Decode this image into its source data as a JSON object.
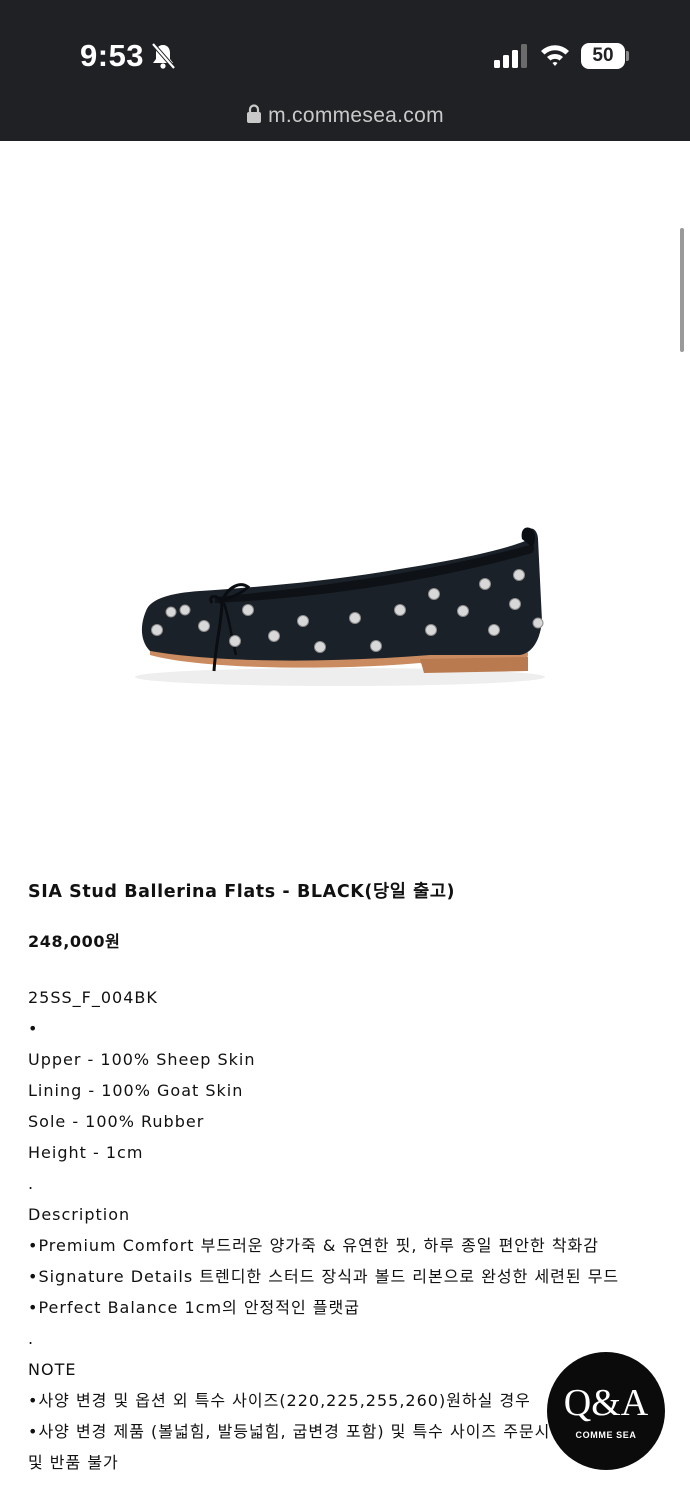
{
  "status_bar": {
    "time": "9:53",
    "battery": "50"
  },
  "browser": {
    "url": "m.commesea.com"
  },
  "product": {
    "image_alt": "black leather ballerina flat with silver studs",
    "title": "SIA Stud Ballerina Flats - BLACK(당일 출고)",
    "price": "248,000원",
    "description_lines": [
      "25SS_F_004BK",
      "•",
      "Upper - 100% Sheep Skin",
      "Lining - 100% Goat Skin",
      "Sole - 100% Rubber",
      "Height - 1cm",
      ".",
      "Description",
      "•Premium Comfort 부드러운 양가죽 & 유연한 핏, 하루 종일 편안한 착화감",
      "•Signature Details 트렌디한 스터드 장식과 볼드 리본으로 완성한 세련된 무드",
      "•Perfect Balance 1cm의 안정적인 플랫굽",
      ".",
      "NOTE",
      "•사양 변경 및 옵션 외 특수 사이즈(220,225,255,260)원하실 경우",
      "•사양 변경 제품 (볼넓힘, 발등넓힘, 굽변경 포함) 및 특수 사이즈 주문시 교환",
      "및 반품 불가"
    ]
  },
  "qa_badge": {
    "label": "Q&A",
    "brand": "COMME SEA"
  },
  "colors": {
    "status_bar_bg": "#202124",
    "badge_bg": "#0b0b0b",
    "text": "#111111"
  }
}
